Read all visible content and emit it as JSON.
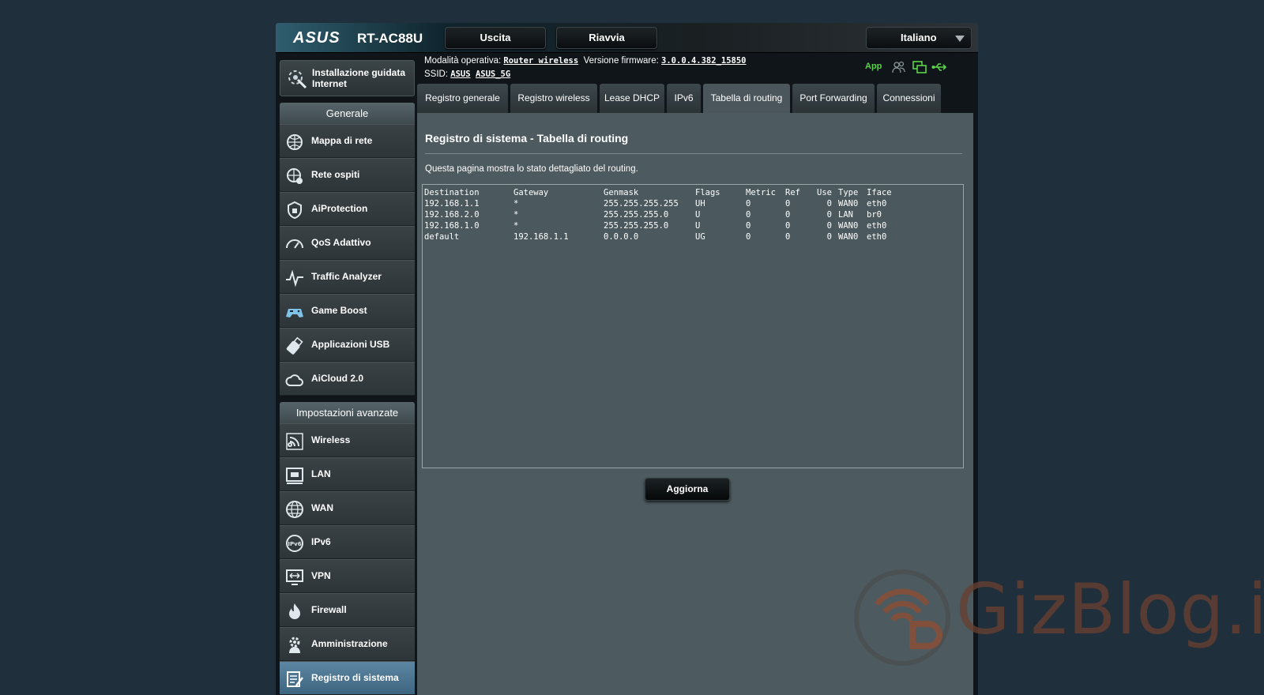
{
  "header": {
    "brand": "ASUS",
    "model": "RT-AC88U",
    "logout_label": "Uscita",
    "reboot_label": "Riavvia",
    "language": "Italiano"
  },
  "status": {
    "mode_label": "Modalità operativa:",
    "mode_value": "Router wireless",
    "firmware_label": "Versione firmware:",
    "firmware_value": "3.0.0.4.382_15850",
    "ssid_label": "SSID:",
    "ssid_1": "ASUS",
    "ssid_2": "ASUS_5G",
    "app_label": "App"
  },
  "sidebar": {
    "quick_setup": "Installazione guidata Internet",
    "general_title": "Generale",
    "general_items": [
      {
        "label": "Mappa di rete",
        "icon": "network-map-icon"
      },
      {
        "label": "Rete ospiti",
        "icon": "guest-network-icon"
      },
      {
        "label": "AiProtection",
        "icon": "aiprotection-icon"
      },
      {
        "label": "QoS Adattivo",
        "icon": "qos-gauge-icon"
      },
      {
        "label": "Traffic Analyzer",
        "icon": "traffic-analyzer-icon"
      },
      {
        "label": "Game Boost",
        "icon": "gamepad-icon"
      },
      {
        "label": "Applicazioni USB",
        "icon": "usb-apps-icon"
      },
      {
        "label": "AiCloud 2.0",
        "icon": "cloud-icon"
      }
    ],
    "advanced_title": "Impostazioni avanzate",
    "advanced_items": [
      {
        "label": "Wireless",
        "icon": "wireless-icon"
      },
      {
        "label": "LAN",
        "icon": "lan-icon"
      },
      {
        "label": "WAN",
        "icon": "wan-globe-icon"
      },
      {
        "label": "IPv6",
        "icon": "ipv6-icon"
      },
      {
        "label": "VPN",
        "icon": "vpn-icon"
      },
      {
        "label": "Firewall",
        "icon": "firewall-icon"
      },
      {
        "label": "Amministrazione",
        "icon": "administration-icon"
      },
      {
        "label": "Registro di sistema",
        "icon": "system-log-icon"
      }
    ]
  },
  "tabs": [
    {
      "label": "Registro generale"
    },
    {
      "label": "Registro wireless"
    },
    {
      "label": "Lease DHCP"
    },
    {
      "label": "IPv6"
    },
    {
      "label": "Tabella di routing"
    },
    {
      "label": "Port Forwarding"
    },
    {
      "label": "Connessioni"
    }
  ],
  "main": {
    "title": "Registro di sistema - Tabella di routing",
    "description": "Questa pagina mostra lo stato dettagliato del routing.",
    "refresh_label": "Aggiorna"
  },
  "routing_table": {
    "headers": [
      "Destination",
      "Gateway",
      "Genmask",
      "Flags",
      "Metric",
      "Ref",
      "Use",
      "Type",
      "Iface"
    ],
    "rows": [
      [
        "192.168.1.1",
        "*",
        "255.255.255.255",
        "UH",
        "0",
        "0",
        "0",
        "WAN0",
        "eth0"
      ],
      [
        "192.168.2.0",
        "*",
        "255.255.255.0",
        "U",
        "0",
        "0",
        "0",
        "LAN",
        "br0"
      ],
      [
        "192.168.1.0",
        "*",
        "255.255.255.0",
        "U",
        "0",
        "0",
        "0",
        "WAN0",
        "eth0"
      ],
      [
        "default",
        "192.168.1.1",
        "0.0.0.0",
        "UG",
        "0",
        "0",
        "0",
        "WAN0",
        "eth0"
      ]
    ]
  },
  "watermark": "GizBlog.it"
}
